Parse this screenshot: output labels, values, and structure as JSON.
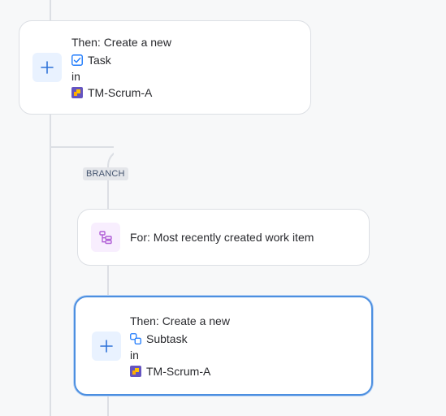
{
  "colors": {
    "connector": "#dcdfe4",
    "add_tile_bg": "#e9f2ff",
    "add_icon": "#2f73d8",
    "branch_tile_bg": "#f8eefe",
    "branch_icon": "#b05ed6",
    "selected_border": "#4c8fe0",
    "project_icon_bg": "#6554c0",
    "project_icon_fg": "#ffc400"
  },
  "action1": {
    "icon": "plus-icon",
    "line1": "Then: Create a new",
    "issue_type_icon": "task-checkbox-icon",
    "issue_type": "Task",
    "in_label": "in",
    "project_icon": "project-avatar-icon",
    "project": "TM-Scrum-A"
  },
  "branch_label": "BRANCH",
  "branch_condition": {
    "icon": "branch-icon",
    "text": "For: Most recently created work item"
  },
  "action2": {
    "icon": "plus-icon",
    "line1": "Then: Create a new",
    "issue_type_icon": "subtask-icon",
    "issue_type": "Subtask",
    "in_label": "in",
    "project_icon": "project-avatar-icon",
    "project": "TM-Scrum-A"
  }
}
